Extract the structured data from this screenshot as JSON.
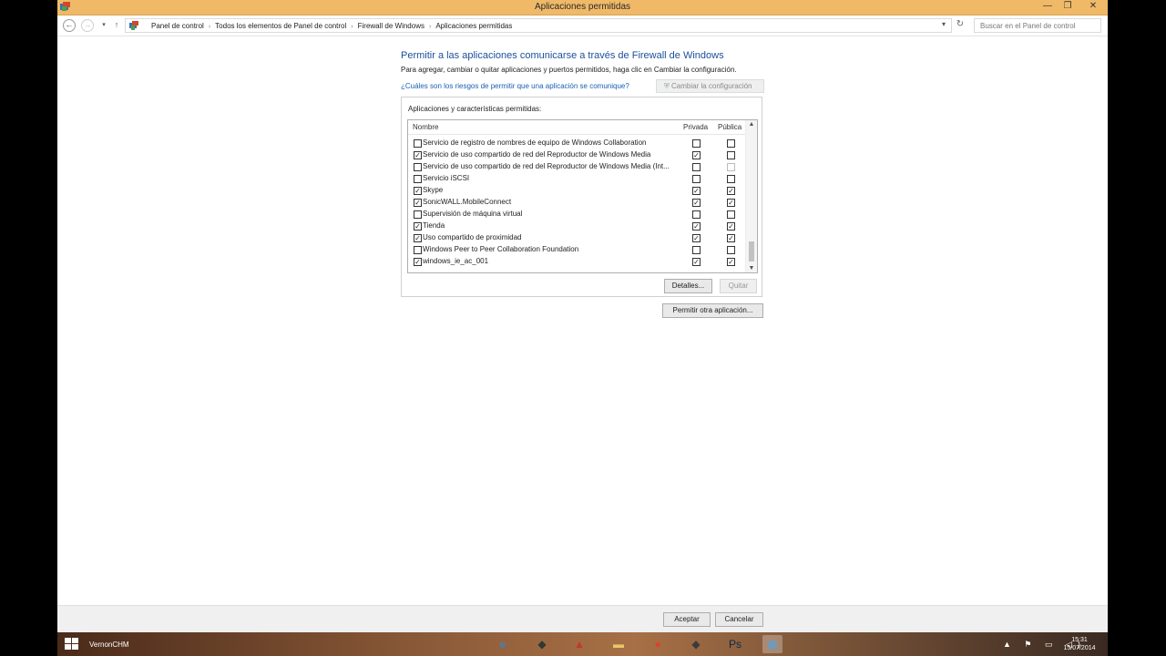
{
  "window": {
    "title": "Aplicaciones permitidas",
    "minimize": "—",
    "maximize": "❐",
    "close": "✕"
  },
  "address": {
    "breadcrumbs": [
      "Panel de control",
      "Todos los elementos de Panel de control",
      "Firewall de Windows",
      "Aplicaciones permitidas"
    ],
    "search_placeholder": "Buscar en el Panel de control"
  },
  "page": {
    "heading": "Permitir a las aplicaciones comunicarse a través de Firewall de Windows",
    "intro": "Para agregar, cambiar o quitar aplicaciones y puertos permitidos, haga clic en Cambiar la configuración.",
    "risk_link": "¿Cuáles son los riesgos de permitir que una aplicación se comunique?",
    "change_settings": "Cambiar la configuración",
    "group_label": "Aplicaciones y características permitidas:",
    "columns": {
      "name": "Nombre",
      "private": "Privada",
      "public": "Pública"
    },
    "apps": [
      {
        "name": "Servicio de registro de nombres de equipo de Windows Collaboration",
        "enabled": false,
        "private": false,
        "public": false
      },
      {
        "name": "Servicio de uso compartido de red del Reproductor de Windows Media",
        "enabled": true,
        "private": true,
        "public": false
      },
      {
        "name": "Servicio de uso compartido de red del Reproductor de Windows Media (Int...",
        "enabled": false,
        "private": false,
        "public": false,
        "public_dim": true
      },
      {
        "name": "Servicio iSCSI",
        "enabled": false,
        "private": false,
        "public": false
      },
      {
        "name": "Skype",
        "enabled": true,
        "private": true,
        "public": true
      },
      {
        "name": "SonicWALL.MobileConnect",
        "enabled": true,
        "private": true,
        "public": true
      },
      {
        "name": "Supervisión de máquina virtual",
        "enabled": false,
        "private": false,
        "public": false
      },
      {
        "name": "Tienda",
        "enabled": true,
        "private": true,
        "public": true
      },
      {
        "name": "Uso compartido de proximidad",
        "enabled": true,
        "private": true,
        "public": true
      },
      {
        "name": "Windows Peer to Peer Collaboration Foundation",
        "enabled": false,
        "private": false,
        "public": false
      },
      {
        "name": "windows_ie_ac_001",
        "enabled": true,
        "private": true,
        "public": true
      }
    ],
    "details_button": "Detalles...",
    "remove_button": "Quitar",
    "allow_other_button": "Permitir otra aplicación..."
  },
  "footer": {
    "ok": "Aceptar",
    "cancel": "Cancelar"
  },
  "taskbar": {
    "user": "VernonCHM",
    "time": "15:31",
    "date": "15/07/2014",
    "apps": [
      {
        "name": "internet-explorer-icon",
        "glyph": "e",
        "color": "#1e8fe0"
      },
      {
        "name": "app-diamond-icon",
        "glyph": "◆",
        "color": "#2f3a2f"
      },
      {
        "name": "app-wing-icon",
        "glyph": "▲",
        "color": "#c0392b"
      },
      {
        "name": "file-explorer-icon",
        "glyph": "▬",
        "color": "#e8c66a"
      },
      {
        "name": "chrome-icon",
        "glyph": "●",
        "color": "#e0402c"
      },
      {
        "name": "app-cube-icon",
        "glyph": "◆",
        "color": "#3a3a3a"
      },
      {
        "name": "photoshop-icon",
        "glyph": "Ps",
        "color": "#0d2a4a"
      },
      {
        "name": "control-panel-icon",
        "glyph": "▦",
        "color": "#5aa0d8"
      }
    ],
    "tray": "▲ ⚑ ▭ ◁)"
  }
}
